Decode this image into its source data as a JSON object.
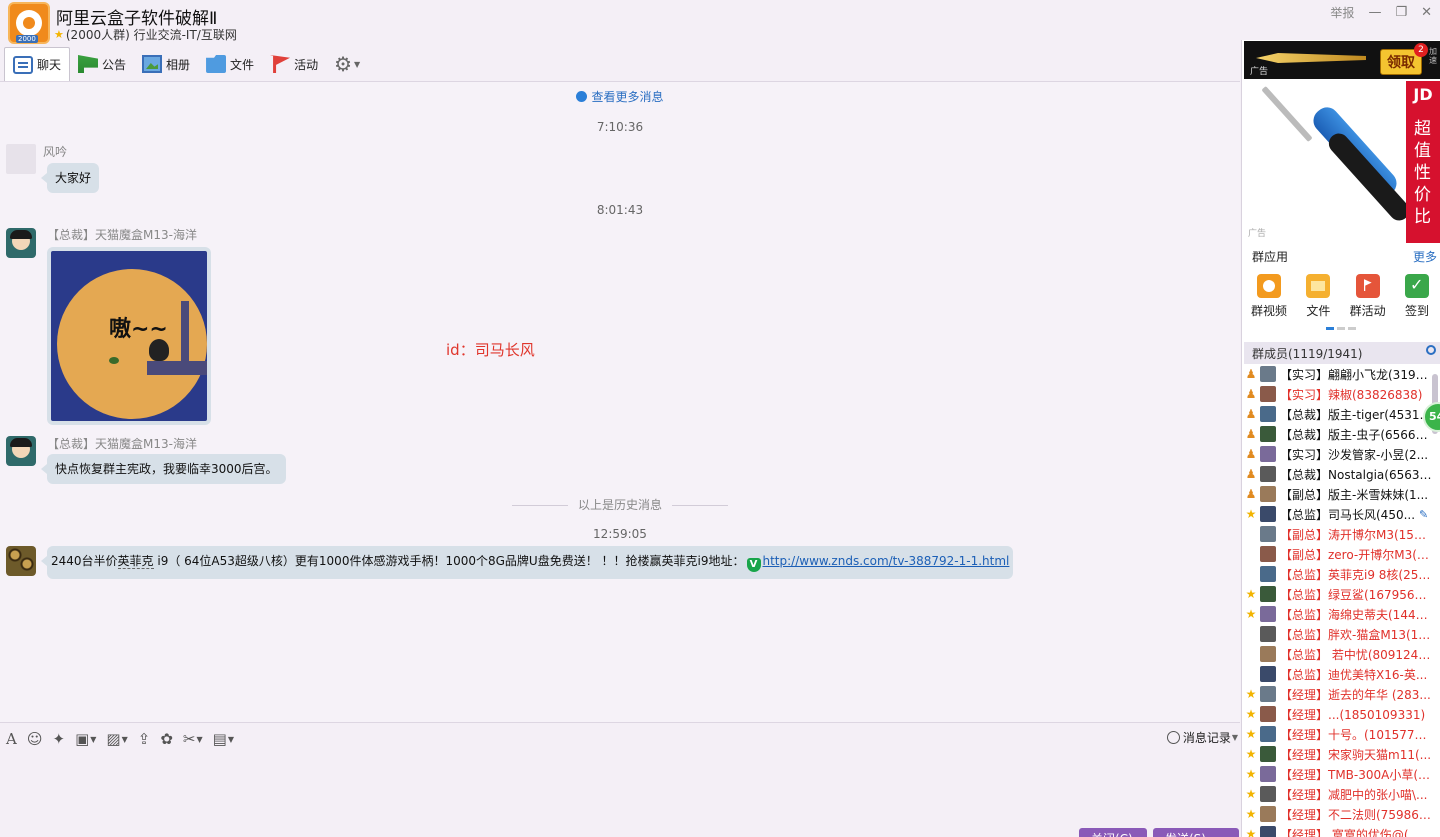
{
  "window": {
    "group_name": "阿里云盒子软件破解Ⅱ",
    "group_info": "(2000人群) 行业交流-IT/互联网",
    "logo_tag": "2000",
    "report_label": "举报",
    "minimize_icon": "—",
    "maximize_icon": "❐",
    "close_icon": "✕"
  },
  "tabs": [
    {
      "label": "聊天",
      "icon": "chat-icon",
      "active": true
    },
    {
      "label": "公告",
      "icon": "notice-icon"
    },
    {
      "label": "相册",
      "icon": "album-icon"
    },
    {
      "label": "文件",
      "icon": "folder-icon"
    },
    {
      "label": "活动",
      "icon": "flag-icon"
    }
  ],
  "chat": {
    "more_messages": "查看更多消息",
    "times": [
      "7:10:36",
      "8:01:43",
      "12:59:05"
    ],
    "messages": [
      {
        "sender": "风吟",
        "text": "大家好"
      },
      {
        "sender": "【总裁】天猫魔盒M13-海洋",
        "image_text": "嗷~~"
      },
      {
        "sender": "【总裁】天猫魔盒M13-海洋",
        "text": "快点恢复群主宪政，我要临幸3000后宫。"
      },
      {
        "text_pre": "2440台半价",
        "text_dotted": "英菲克",
        "text_mid": " i9（ 64位A53超级八核）更有1000件体感游戏手柄！1000个8G品牌U盘免费送！ ！！抢楼赢英菲克i9地址：",
        "badge": "V",
        "link": "http://www.znds.com/tv-388792-1-1.html"
      }
    ],
    "watermark": "id：司马长风",
    "history_divider": "以上是历史消息"
  },
  "input": {
    "history_label": "消息记录",
    "close_label": "关闭(C)",
    "send_label": "发送(S)"
  },
  "sidebar": {
    "ad_top": {
      "label": "广告",
      "button": "领取",
      "badge": "2",
      "side_text": "加速"
    },
    "ad_main": {
      "jd_logo": "JD",
      "slogan": "超值性价比",
      "tag": "广告"
    },
    "apps_title": "群应用",
    "apps_more": "更多",
    "apps": [
      {
        "label": "群视频",
        "icon": "video-icon"
      },
      {
        "label": "文件",
        "icon": "folder-icon"
      },
      {
        "label": "群活动",
        "icon": "activity-icon"
      },
      {
        "label": "签到",
        "icon": "checkin-icon"
      }
    ],
    "members_title": "群成员(1119/1941)",
    "members": [
      {
        "name": "【实习】翩翩小飞龙(3194...",
        "lvl": "owner",
        "color": "black"
      },
      {
        "name": "【实习】辣椒(83826838)",
        "lvl": "owner",
        "color": "red"
      },
      {
        "name": "【总裁】版主-tiger(45310...",
        "lvl": "owner",
        "color": "black"
      },
      {
        "name": "【总裁】版主-虫子(65668...",
        "lvl": "owner",
        "color": "black"
      },
      {
        "name": "【实习】沙发管家-小昱(2...",
        "lvl": "owner",
        "color": "black"
      },
      {
        "name": "【总裁】Nostalgia(65639930)",
        "lvl": "owner",
        "color": "black"
      },
      {
        "name": "【副总】版主-米雪妹妹(1...",
        "lvl": "owner",
        "color": "black"
      },
      {
        "name": "【总监】司马长风(450...",
        "lvl": "admin",
        "color": "black",
        "edit": true
      },
      {
        "name": "【副总】涛开博尔M3(159...",
        "lvl": "none",
        "color": "red"
      },
      {
        "name": "【副总】zero-开博尔M3(5...",
        "lvl": "none",
        "color": "red"
      },
      {
        "name": "【总监】英菲克i9 8核(251...",
        "lvl": "none",
        "color": "red"
      },
      {
        "name": "【总监】绿豆鲨(167956588)",
        "lvl": "admin",
        "color": "red"
      },
      {
        "name": "【总监】海绵史蒂夫(1448...",
        "lvl": "admin",
        "color": "red"
      },
      {
        "name": "【总监】胖欢-猫盒M13(15...",
        "lvl": "none",
        "color": "red"
      },
      {
        "name": "【总监】 若中忧(80912438)",
        "lvl": "none",
        "color": "red"
      },
      {
        "name": "【总监】迪优美特X16-英...",
        "lvl": "none",
        "color": "red"
      },
      {
        "name": "【经理】逝去的年华 (283...",
        "lvl": "admin",
        "color": "red"
      },
      {
        "name": "【经理】...(1850109331)",
        "lvl": "admin",
        "color": "red"
      },
      {
        "name": "【经理】十号。(10157740...",
        "lvl": "admin",
        "color": "red"
      },
      {
        "name": "【经理】宋家驹天猫m11(...",
        "lvl": "admin",
        "color": "red"
      },
      {
        "name": "【经理】TMB-300A小草(1...",
        "lvl": "admin",
        "color": "red"
      },
      {
        "name": "【经理】减肥中的张小喵\\...",
        "lvl": "admin",
        "color": "red"
      },
      {
        "name": "【经理】不二法则(759862...",
        "lvl": "admin",
        "color": "red"
      },
      {
        "name": "【经理】 寞寞的优伤@(...",
        "lvl": "admin",
        "color": "red"
      }
    ],
    "float_badge": "54"
  }
}
